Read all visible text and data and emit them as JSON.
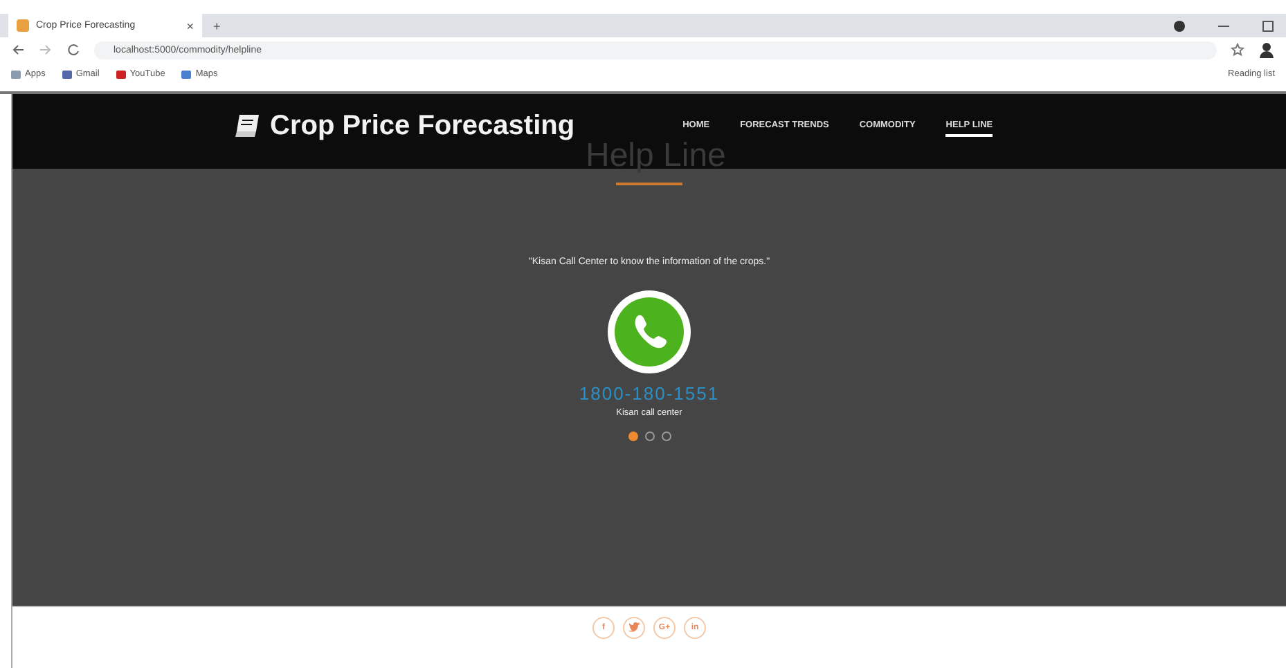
{
  "browser": {
    "tab_title": "Crop Price Forecasting",
    "tab_close": "×",
    "new_tab": "+",
    "url": "localhost:5000/commodity/helpline",
    "bookmarks": [
      "Apps",
      "Gmail",
      "YouTube",
      "Maps"
    ],
    "reading_list": "Reading list"
  },
  "navbar": {
    "brand": "Crop Price Forecasting",
    "links": [
      {
        "label": "HOME",
        "selected": false
      },
      {
        "label": "FORECAST TRENDS",
        "selected": false
      },
      {
        "label": "COMMODITY",
        "selected": false
      },
      {
        "label": "HELP LINE",
        "selected": true
      }
    ]
  },
  "section": {
    "heading": "Help Line",
    "quote": "\"Kisan Call Center to know the information of the crops.\"",
    "phone": "1800-180-1551",
    "caption": "Kisan call center",
    "dots": [
      {
        "selected": true
      },
      {
        "selected": false
      },
      {
        "selected": false
      }
    ]
  },
  "footer": {
    "social": [
      {
        "kind": "facebook",
        "label": "f"
      },
      {
        "kind": "twitter"
      },
      {
        "kind": "google",
        "label": "G+"
      },
      {
        "kind": "linkedin",
        "label": "in"
      }
    ]
  }
}
